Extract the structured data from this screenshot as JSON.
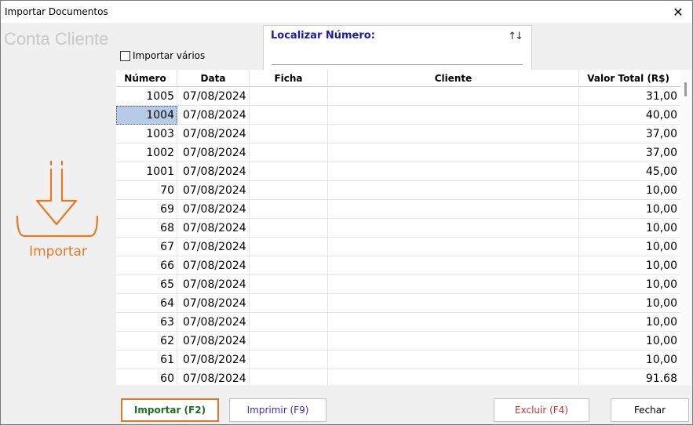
{
  "window": {
    "title": "Importar Documentos",
    "close_glyph": "✕"
  },
  "brand_text": "Conta Cliente",
  "import_multiple_label": "Importar vários",
  "search": {
    "label": "Localizar Número:",
    "value": "",
    "sort_glyph": "↑↓"
  },
  "import_panel_label": "Importar",
  "grid": {
    "headers": {
      "numero": "Número",
      "data": "Data",
      "ficha": "Ficha",
      "cliente": "Cliente",
      "valor": "Valor Total (R$)"
    },
    "rows": [
      {
        "numero": "1005",
        "data": "07/08/2024",
        "ficha": "",
        "cliente": "",
        "valor": "31,00"
      },
      {
        "numero": "1004",
        "data": "07/08/2024",
        "ficha": "",
        "cliente": "",
        "valor": "40,00"
      },
      {
        "numero": "1003",
        "data": "07/08/2024",
        "ficha": "",
        "cliente": "",
        "valor": "37,00"
      },
      {
        "numero": "1002",
        "data": "07/08/2024",
        "ficha": "",
        "cliente": "",
        "valor": "37,00"
      },
      {
        "numero": "1001",
        "data": "07/08/2024",
        "ficha": "",
        "cliente": "",
        "valor": "45,00"
      },
      {
        "numero": "70",
        "data": "07/08/2024",
        "ficha": "",
        "cliente": "",
        "valor": "10,00"
      },
      {
        "numero": "69",
        "data": "07/08/2024",
        "ficha": "",
        "cliente": "",
        "valor": "10,00"
      },
      {
        "numero": "68",
        "data": "07/08/2024",
        "ficha": "",
        "cliente": "",
        "valor": "10,00"
      },
      {
        "numero": "67",
        "data": "07/08/2024",
        "ficha": "",
        "cliente": "",
        "valor": "10,00"
      },
      {
        "numero": "66",
        "data": "07/08/2024",
        "ficha": "",
        "cliente": "",
        "valor": "10,00"
      },
      {
        "numero": "65",
        "data": "07/08/2024",
        "ficha": "",
        "cliente": "",
        "valor": "10,00"
      },
      {
        "numero": "64",
        "data": "07/08/2024",
        "ficha": "",
        "cliente": "",
        "valor": "10,00"
      },
      {
        "numero": "63",
        "data": "07/08/2024",
        "ficha": "",
        "cliente": "",
        "valor": "10,00"
      },
      {
        "numero": "62",
        "data": "07/08/2024",
        "ficha": "",
        "cliente": "",
        "valor": "10,00"
      },
      {
        "numero": "61",
        "data": "07/08/2024",
        "ficha": "",
        "cliente": "",
        "valor": "10,00"
      },
      {
        "numero": "60",
        "data": "07/08/2024",
        "ficha": "",
        "cliente": "",
        "valor": "91.68"
      }
    ],
    "selected_row": "1004"
  },
  "buttons": {
    "importar": "Importar (F2)",
    "imprimir": "Imprimir (F9)",
    "excluir": "Excluir (F4)",
    "fechar": "Fechar"
  },
  "colors": {
    "accent_orange": "#e87722",
    "selection_blue": "#b7cbe8",
    "search_label_blue": "#1a1aa6"
  }
}
